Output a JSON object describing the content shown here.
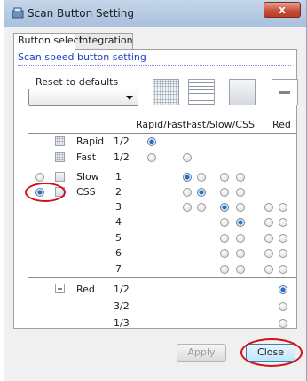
{
  "window": {
    "title": "Scan Button Setting",
    "close_glyph": "x"
  },
  "tabs": [
    {
      "label": "Button select",
      "active": true
    },
    {
      "label": "Integration",
      "active": false
    }
  ],
  "section": {
    "title": "Scan speed button setting"
  },
  "reset": {
    "label": "Reset to defaults",
    "value": ""
  },
  "columns": [
    {
      "label": "Rapid/Fast",
      "icon": "rapid-pattern-icon"
    },
    {
      "label": "Fast/Slow/CSS",
      "icon": "line-pattern-icon"
    },
    {
      "label": "Red",
      "icon": "red-bar-icon"
    }
  ],
  "speed_rows": [
    {
      "name": "Rapid",
      "value": "1/2",
      "icon": "rapid-pattern-icon"
    },
    {
      "name": "Fast",
      "value": "1/2",
      "icon": "rapid-pattern-icon"
    },
    {
      "name": "Slow",
      "value": "1",
      "icon": "plain-square-icon"
    },
    {
      "name": "CSS",
      "value": "2",
      "icon": "dotted-square-icon"
    }
  ],
  "css_values": [
    "3",
    "4",
    "5",
    "6",
    "7"
  ],
  "red_rows": [
    {
      "name": "Red",
      "value": "1/2"
    },
    {
      "value": "3/2"
    },
    {
      "value": "1/3"
    }
  ],
  "buttons": {
    "apply": "Apply",
    "close": "Close"
  },
  "colors": {
    "section_title": "#1a3fc2",
    "annotation": "#d0121a",
    "radio_selected": "#2a6fb8"
  }
}
